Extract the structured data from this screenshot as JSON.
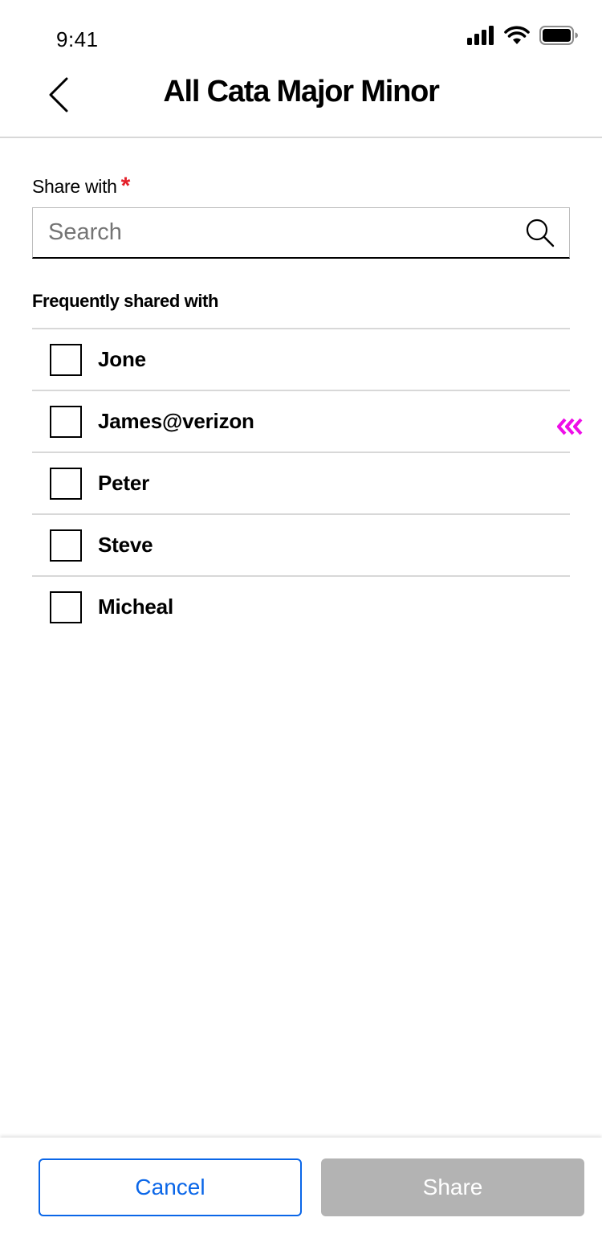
{
  "status_bar": {
    "time": "9:41",
    "icons": [
      "signal-bars-icon",
      "wifi-icon",
      "battery-icon"
    ]
  },
  "header": {
    "back_icon": "chevron-left-icon",
    "title": "All Cata Major Minor"
  },
  "share_with": {
    "label": "Share with",
    "required_marker": "*",
    "search": {
      "placeholder": "Search",
      "value": "",
      "icon": "search-icon"
    }
  },
  "frequent": {
    "heading": "Frequently shared with",
    "contacts": [
      {
        "name": "Jone",
        "checked": false
      },
      {
        "name": "James@verizon",
        "checked": false
      },
      {
        "name": "Peter",
        "checked": false
      },
      {
        "name": "Steve",
        "checked": false
      },
      {
        "name": "Micheal",
        "checked": false
      }
    ]
  },
  "drag_indicator": {
    "icon": "triple-chevron-left-icon",
    "color": "#ee0ee8"
  },
  "footer": {
    "cancel_label": "Cancel",
    "share_label": "Share"
  },
  "colors": {
    "accent": "#0a66e8",
    "required": "#e4202a",
    "disabled_button": "#b3b3b3",
    "divider": "#d8d8d8"
  }
}
